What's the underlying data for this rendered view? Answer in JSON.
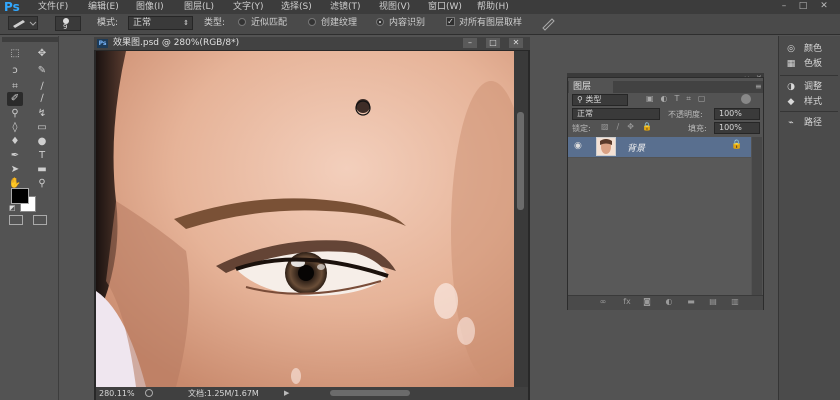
{
  "app": {
    "logo": "Ps"
  },
  "menu": [
    {
      "label": "文件(F)"
    },
    {
      "label": "编辑(E)"
    },
    {
      "label": "图像(I)"
    },
    {
      "label": "图层(L)"
    },
    {
      "label": "文字(Y)"
    },
    {
      "label": "选择(S)"
    },
    {
      "label": "滤镜(T)"
    },
    {
      "label": "视图(V)"
    },
    {
      "label": "窗口(W)"
    },
    {
      "label": "帮助(H)"
    }
  ],
  "window_controls": {
    "minimize": "–",
    "maximize": "□",
    "close": "✕"
  },
  "options": {
    "brush_size": "9",
    "mode_label": "模式:",
    "mode_value": "正常",
    "type_label": "类型:",
    "type_options": [
      "近似匹配",
      "创建纹理",
      "内容识别"
    ],
    "type_selected": "内容识别",
    "sample_all_label": "对所有图层取样",
    "sample_all_checked": true
  },
  "document": {
    "title": "效果图.psd @ 280%(RGB/8*)",
    "zoom": "280.11%",
    "doc_info": "文档:1.25M/1.67M"
  },
  "layers_panel": {
    "tab": "图层",
    "filter_label": "类型",
    "blend_mode": "正常",
    "opacity_label": "不透明度:",
    "opacity_value": "100%",
    "lock_label": "锁定:",
    "fill_label": "填充:",
    "fill_value": "100%",
    "layers": [
      {
        "name": "背景",
        "visible": true,
        "locked": true
      }
    ]
  },
  "dock": [
    {
      "label": "颜色",
      "icon": "color-icon"
    },
    {
      "label": "色板",
      "icon": "swatches-icon"
    },
    {
      "label": "调整",
      "icon": "adjustments-icon"
    },
    {
      "label": "样式",
      "icon": "styles-icon"
    },
    {
      "label": "路径",
      "icon": "paths-icon"
    }
  ],
  "colors": {
    "accent": "#31a8ff",
    "foreground": "#000000",
    "background": "#ffffff",
    "selected_layer": "#596f8f"
  }
}
